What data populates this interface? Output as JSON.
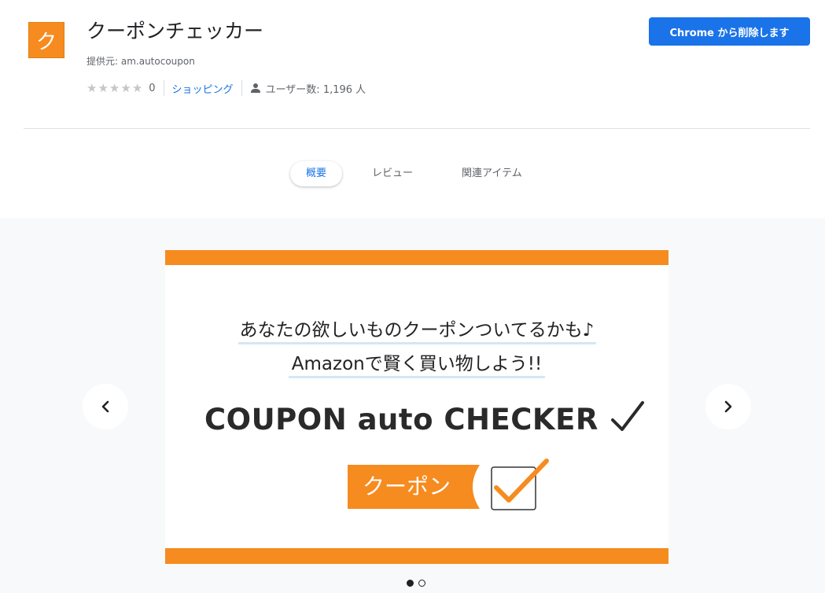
{
  "extension": {
    "icon_glyph": "ク",
    "icon_color": "#f68b1f",
    "title": "クーポンチェッカー",
    "provider": "提供元: am.autocoupon",
    "rating_count": "0",
    "category": "ショッピング",
    "users": "ユーザー数: 1,196 人"
  },
  "actions": {
    "remove_button": "Chrome から削除します",
    "accent_color": "#1a73e8"
  },
  "tabs": [
    {
      "label": "概要",
      "active": true
    },
    {
      "label": "レビュー",
      "active": false
    },
    {
      "label": "関連アイテム",
      "active": false
    }
  ],
  "slide": {
    "line1": "あなたの欲しいものクーポンついてるかも♪",
    "line2": "Amazonで賢く買い物しよう!!",
    "brand": "COUPON auto CHECKER",
    "coupon_label": "クーポン",
    "accent_color": "#f68b1f"
  },
  "gallery": {
    "prev_icon": "chevron-left-icon",
    "next_icon": "chevron-right-icon",
    "slide_count": 2,
    "active_index": 0
  }
}
